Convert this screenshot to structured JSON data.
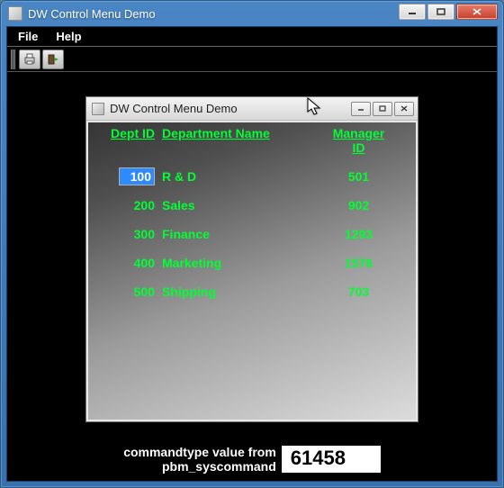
{
  "window": {
    "title": "DW Control Menu Demo"
  },
  "menubar": {
    "items": [
      "File",
      "Help"
    ]
  },
  "toolbar": {
    "buttons": [
      {
        "name": "print-icon"
      },
      {
        "name": "exit-icon"
      }
    ]
  },
  "child_window": {
    "title": "DW Control Menu Demo"
  },
  "datawindow": {
    "columns": {
      "dept": "Dept ID",
      "name": "Department Name",
      "mgr_line1": "Manager",
      "mgr_line2": "ID"
    },
    "rows": [
      {
        "dept": "100",
        "name": "R & D",
        "mgr": "501",
        "selected": true
      },
      {
        "dept": "200",
        "name": "Sales",
        "mgr": "902",
        "selected": false
      },
      {
        "dept": "300",
        "name": "Finance",
        "mgr": "1293",
        "selected": false
      },
      {
        "dept": "400",
        "name": "Marketing",
        "mgr": "1576",
        "selected": false
      },
      {
        "dept": "500",
        "name": "Shipping",
        "mgr": "703",
        "selected": false
      }
    ]
  },
  "footer": {
    "label_line1": "commandtype value from",
    "label_line2": "pbm_syscommand",
    "value": "61458"
  }
}
